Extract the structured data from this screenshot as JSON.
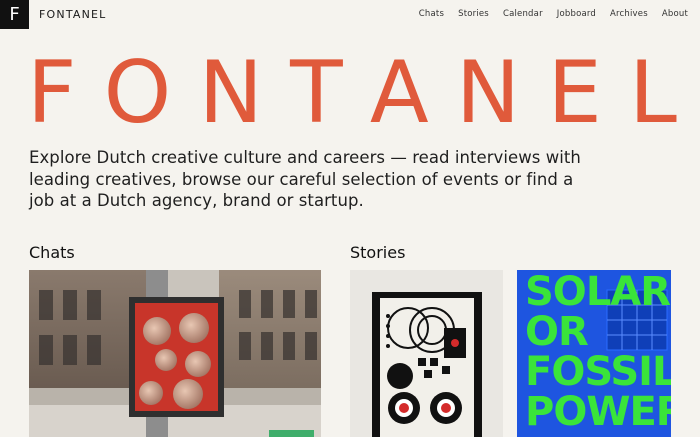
{
  "brand": {
    "logo_letter": "F",
    "name": "FONTANEL"
  },
  "nav": [
    {
      "label": "Chats"
    },
    {
      "label": "Stories"
    },
    {
      "label": "Calendar"
    },
    {
      "label": "Jobboard"
    },
    {
      "label": "Archives"
    },
    {
      "label": "About"
    }
  ],
  "hero": {
    "letters": [
      "F",
      "O",
      "N",
      "T",
      "A",
      "N",
      "E",
      "L"
    ],
    "color": "#e05a3b"
  },
  "intro": "Explore Dutch creative culture and careers — read interviews with leading creatives, browse our careful selection of events or find a job at a Dutch agency, brand or startup.",
  "sections": {
    "chats": {
      "title": "Chats"
    },
    "stories": {
      "title": "Stories",
      "card2_text": "SOLAR OR FOSSIL POWER?"
    }
  },
  "colors": {
    "background": "#f5f3ee",
    "accent": "#e05a3b",
    "poster_blue": "#1e55e0",
    "poster_green": "#3ae43a"
  }
}
